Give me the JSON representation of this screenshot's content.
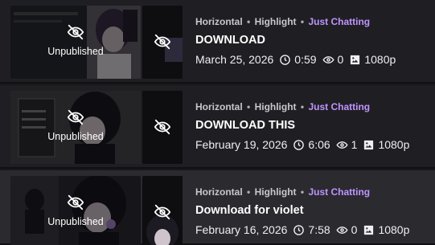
{
  "rows": [
    {
      "format": "Horizontal",
      "type": "Highlight",
      "category": "Just Chatting",
      "title": "DOWNLOAD",
      "date": "March 25, 2026",
      "duration": "0:59",
      "views": "0",
      "quality": "1080p",
      "status": "Unpublished"
    },
    {
      "format": "Horizontal",
      "type": "Highlight",
      "category": "Just Chatting",
      "title": "DOWNLOAD THIS",
      "date": "February 19, 2026",
      "duration": "6:06",
      "views": "1",
      "quality": "1080p",
      "status": "Unpublished"
    },
    {
      "format": "Horizontal",
      "type": "Highlight",
      "category": "Just Chatting",
      "title": "Download for violet",
      "date": "February 16, 2026",
      "duration": "7:58",
      "views": "0",
      "quality": "1080p",
      "status": "Unpublished"
    }
  ],
  "separator": "•",
  "icons": {
    "status": "eye-off-icon",
    "duration": "clock-icon",
    "views": "eye-icon",
    "quality": "image-icon"
  },
  "colors": {
    "category": "#bf94ff",
    "background": "#1f1f23",
    "hover_row": "#2a2a2f"
  }
}
